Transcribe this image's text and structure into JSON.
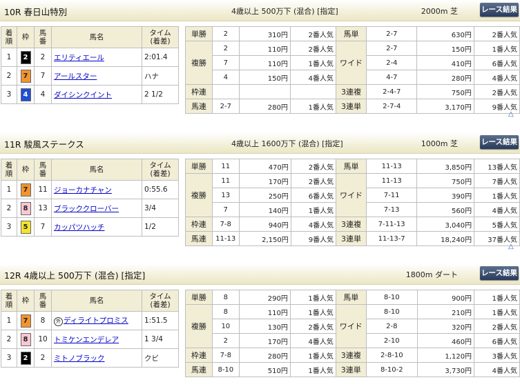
{
  "headers": {
    "ranking": "着\n順",
    "frame": "枠",
    "number": "馬\n番",
    "horse": "馬名",
    "time": "タイム\n(着差)"
  },
  "colors": {
    "frame_1": "#ffffff",
    "frame_2": "#000000",
    "frame_4": "#1f4fd6",
    "frame_5": "#f2e52b",
    "frame_7": "#f2942e",
    "frame_8": "#f7c7d2",
    "header_bg": "#f2eed6",
    "button_bg": "#364968"
  },
  "races": [
    {
      "title": "10R 春日山特別",
      "conditions": "4歳以上 500万下 (混合) [指定]",
      "distance": "2000m  芝",
      "button": "レース結果",
      "results": [
        {
          "rank": "1",
          "frame": "2",
          "frame_color": "#000000",
          "frame_text": "#ffffff",
          "num": "2",
          "name": "エリティエール",
          "name_icon": "",
          "time": "2:01.4"
        },
        {
          "rank": "2",
          "frame": "7",
          "frame_color": "#f2942e",
          "frame_text": "#222222",
          "num": "7",
          "name": "アールスター",
          "name_icon": "",
          "time": "ハナ"
        },
        {
          "rank": "3",
          "frame": "4",
          "frame_color": "#1f4fd6",
          "frame_text": "#ffffff",
          "num": "4",
          "name": "ダイシンクイント",
          "name_icon": "",
          "time": "2 1/2"
        }
      ],
      "payouts": [
        {
          "label": "単勝",
          "nums": [
            "2"
          ],
          "amounts": [
            "310円"
          ],
          "pops": [
            "2番人気"
          ],
          "label2": "馬単",
          "nums2": [
            "2-7"
          ],
          "amounts2": [
            "630円"
          ],
          "pops2": [
            "2番人気"
          ]
        },
        {
          "label": "複勝",
          "nums": [
            "2",
            "7",
            "4"
          ],
          "amounts": [
            "110円",
            "110円",
            "150円"
          ],
          "pops": [
            "2番人気",
            "1番人気",
            "4番人気"
          ],
          "label2": "ワイド",
          "nums2": [
            "2-7",
            "2-4",
            "4-7"
          ],
          "amounts2": [
            "150円",
            "410円",
            "280円"
          ],
          "pops2": [
            "1番人気",
            "6番人気",
            "4番人気"
          ]
        },
        {
          "label": "枠連",
          "nums": [
            ""
          ],
          "amounts": [
            ""
          ],
          "pops": [
            ""
          ],
          "label2": "3連複",
          "nums2": [
            "2-4-7"
          ],
          "amounts2": [
            "750円"
          ],
          "pops2": [
            "2番人気"
          ]
        },
        {
          "label": "馬連",
          "nums": [
            "2-7"
          ],
          "amounts": [
            "280円"
          ],
          "pops": [
            "1番人気"
          ],
          "label2": "3連単",
          "nums2": [
            "2-7-4"
          ],
          "amounts2": [
            "3,170円"
          ],
          "pops2": [
            "9番人気"
          ]
        }
      ]
    },
    {
      "title": "11R 駿風ステークス",
      "conditions": "4歳以上 1600万下 (混合) [指定]",
      "distance": "1000m  芝",
      "button": "レース結果",
      "results": [
        {
          "rank": "1",
          "frame": "7",
          "frame_color": "#f2942e",
          "frame_text": "#222222",
          "num": "11",
          "name": "ジョーカナチャン",
          "name_icon": "",
          "time": "0:55.6"
        },
        {
          "rank": "2",
          "frame": "8",
          "frame_color": "#f7c7d2",
          "frame_text": "#222222",
          "num": "13",
          "name": "ブラッククローバー",
          "name_icon": "",
          "time": "3/4"
        },
        {
          "rank": "3",
          "frame": "5",
          "frame_color": "#f2e52b",
          "frame_text": "#222222",
          "num": "7",
          "name": "カッパツハッチ",
          "name_icon": "",
          "time": "1/2"
        }
      ],
      "payouts": [
        {
          "label": "単勝",
          "nums": [
            "11"
          ],
          "amounts": [
            "470円"
          ],
          "pops": [
            "2番人気"
          ],
          "label2": "馬単",
          "nums2": [
            "11-13"
          ],
          "amounts2": [
            "3,850円"
          ],
          "pops2": [
            "13番人気"
          ]
        },
        {
          "label": "複勝",
          "nums": [
            "11",
            "13",
            "7"
          ],
          "amounts": [
            "170円",
            "250円",
            "140円"
          ],
          "pops": [
            "2番人気",
            "6番人気",
            "1番人気"
          ],
          "label2": "ワイド",
          "nums2": [
            "11-13",
            "7-11",
            "7-13"
          ],
          "amounts2": [
            "750円",
            "390円",
            "560円"
          ],
          "pops2": [
            "7番人気",
            "1番人気",
            "4番人気"
          ]
        },
        {
          "label": "枠連",
          "nums": [
            "7-8"
          ],
          "amounts": [
            "940円"
          ],
          "pops": [
            "4番人気"
          ],
          "label2": "3連複",
          "nums2": [
            "7-11-13"
          ],
          "amounts2": [
            "3,040円"
          ],
          "pops2": [
            "5番人気"
          ]
        },
        {
          "label": "馬連",
          "nums": [
            "11-13"
          ],
          "amounts": [
            "2,150円"
          ],
          "pops": [
            "9番人気"
          ],
          "label2": "3連単",
          "nums2": [
            "11-13-7"
          ],
          "amounts2": [
            "18,240円"
          ],
          "pops2": [
            "37番人気"
          ]
        }
      ]
    },
    {
      "title": "12R 4歳以上 500万下 (混合) [指定]",
      "conditions": "",
      "distance": "1800m  ダート",
      "button": "レース結果",
      "results": [
        {
          "rank": "1",
          "frame": "7",
          "frame_color": "#f2942e",
          "frame_text": "#222222",
          "num": "8",
          "name": "ディライトプロミス",
          "name_icon": "外",
          "time": "1:51.5"
        },
        {
          "rank": "2",
          "frame": "8",
          "frame_color": "#f7c7d2",
          "frame_text": "#222222",
          "num": "10",
          "name": "トミケンエンデレア",
          "name_icon": "",
          "time": "1 3/4"
        },
        {
          "rank": "3",
          "frame": "2",
          "frame_color": "#000000",
          "frame_text": "#ffffff",
          "num": "2",
          "name": "ミトノブラック",
          "name_icon": "",
          "time": "クビ"
        }
      ],
      "payouts": [
        {
          "label": "単勝",
          "nums": [
            "8"
          ],
          "amounts": [
            "290円"
          ],
          "pops": [
            "1番人気"
          ],
          "label2": "馬単",
          "nums2": [
            "8-10"
          ],
          "amounts2": [
            "900円"
          ],
          "pops2": [
            "1番人気"
          ]
        },
        {
          "label": "複勝",
          "nums": [
            "8",
            "10",
            "2"
          ],
          "amounts": [
            "110円",
            "130円",
            "170円"
          ],
          "pops": [
            "1番人気",
            "2番人気",
            "4番人気"
          ],
          "label2": "ワイド",
          "nums2": [
            "8-10",
            "2-8",
            "2-10"
          ],
          "amounts2": [
            "210円",
            "320円",
            "460円"
          ],
          "pops2": [
            "1番人気",
            "2番人気",
            "6番人気"
          ]
        },
        {
          "label": "枠連",
          "nums": [
            "7-8"
          ],
          "amounts": [
            "280円"
          ],
          "pops": [
            "1番人気"
          ],
          "label2": "3連複",
          "nums2": [
            "2-8-10"
          ],
          "amounts2": [
            "1,120円"
          ],
          "pops2": [
            "3番人気"
          ]
        },
        {
          "label": "馬連",
          "nums": [
            "8-10"
          ],
          "amounts": [
            "510円"
          ],
          "pops": [
            "1番人気"
          ],
          "label2": "3連単",
          "nums2": [
            "8-10-2"
          ],
          "amounts2": [
            "3,730円"
          ],
          "pops2": [
            "4番人気"
          ]
        }
      ]
    }
  ]
}
